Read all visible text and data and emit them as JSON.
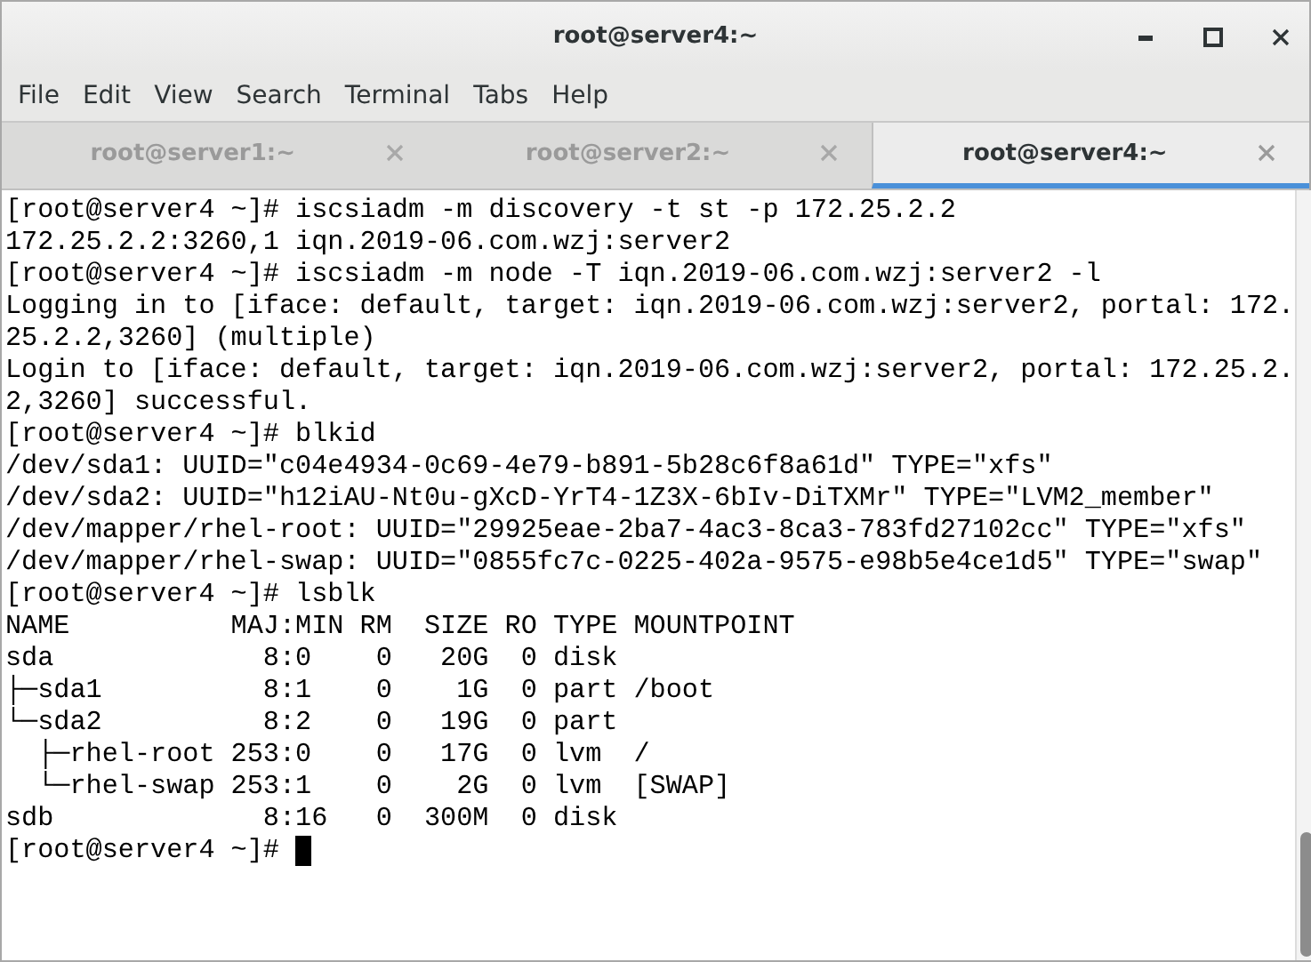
{
  "window": {
    "title": "root@server4:~"
  },
  "menu": [
    "File",
    "Edit",
    "View",
    "Search",
    "Terminal",
    "Tabs",
    "Help"
  ],
  "tabs": [
    {
      "label": "root@server1:~",
      "selected": false
    },
    {
      "label": "root@server2:~",
      "selected": false
    },
    {
      "label": "root@server4:~",
      "selected": true
    }
  ],
  "terminal": {
    "lines": [
      "[root@server4 ~]# iscsiadm -m discovery -t st -p 172.25.2.2",
      "172.25.2.2:3260,1 iqn.2019-06.com.wzj:server2",
      "[root@server4 ~]# iscsiadm -m node -T iqn.2019-06.com.wzj:server2 -l",
      "Logging in to [iface: default, target: iqn.2019-06.com.wzj:server2, portal: 172.",
      "25.2.2,3260] (multiple)",
      "Login to [iface: default, target: iqn.2019-06.com.wzj:server2, portal: 172.25.2.",
      "2,3260] successful.",
      "[root@server4 ~]# blkid",
      "/dev/sda1: UUID=\"c04e4934-0c69-4e79-b891-5b28c6f8a61d\" TYPE=\"xfs\"",
      "/dev/sda2: UUID=\"h12iAU-Nt0u-gXcD-YrT4-1Z3X-6bIv-DiTXMr\" TYPE=\"LVM2_member\"",
      "/dev/mapper/rhel-root: UUID=\"29925eae-2ba7-4ac3-8ca3-783fd27102cc\" TYPE=\"xfs\"",
      "/dev/mapper/rhel-swap: UUID=\"0855fc7c-0225-402a-9575-e98b5e4ce1d5\" TYPE=\"swap\"",
      "[root@server4 ~]# lsblk",
      "NAME          MAJ:MIN RM  SIZE RO TYPE MOUNTPOINT",
      "sda             8:0    0   20G  0 disk",
      "├─sda1          8:1    0    1G  0 part /boot",
      "└─sda2          8:2    0   19G  0 part",
      "  ├─rhel-root 253:0    0   17G  0 lvm  /",
      "  └─rhel-swap 253:1    0    2G  0 lvm  [SWAP]",
      "sdb             8:16   0  300M  0 disk"
    ],
    "prompt": "[root@server4 ~]# "
  }
}
